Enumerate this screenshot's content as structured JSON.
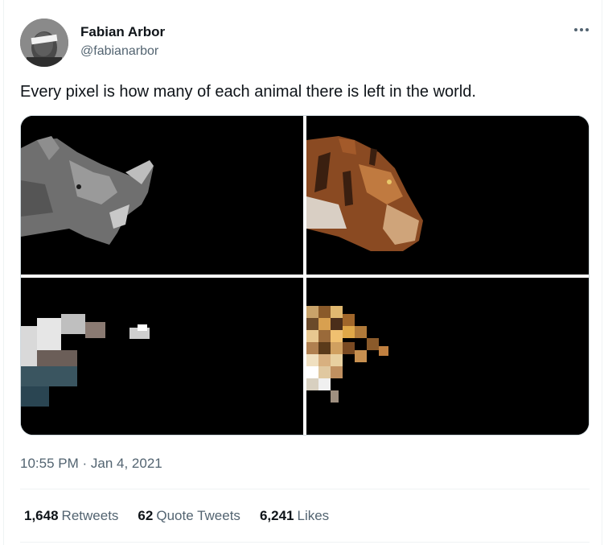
{
  "author": {
    "name": "Fabian Arbor",
    "handle": "@fabianarbor"
  },
  "tweet": {
    "text": "Every pixel is how many of each animal there is left in the world.",
    "timestamp": "10:55 PM · Jan 4, 2021"
  },
  "media": [
    {
      "subject": "rhino",
      "icon": "rhino-image"
    },
    {
      "subject": "tiger",
      "icon": "tiger-image"
    },
    {
      "subject": "eagle",
      "icon": "eagle-image"
    },
    {
      "subject": "leopard",
      "icon": "leopard-image"
    }
  ],
  "stats": {
    "retweets_count": "1,648",
    "retweets_label": "Retweets",
    "quotes_count": "62",
    "quotes_label": "Quote Tweets",
    "likes_count": "6,241",
    "likes_label": "Likes"
  },
  "icons": {
    "more": "more-dots-icon"
  },
  "colors": {
    "text_primary": "#0f1419",
    "text_secondary": "#536471",
    "divider": "#eff3f4",
    "media_bg": "#000000"
  }
}
